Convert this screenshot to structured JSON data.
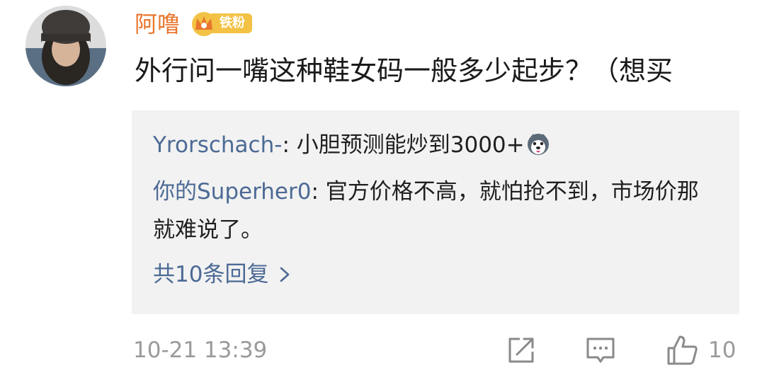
{
  "comment": {
    "username": "阿噜",
    "badge_label": "铁粉",
    "text": "外行问一嘴这种鞋女码一般多少起步？（想买",
    "timestamp": "10-21 13:39",
    "like_count": "10"
  },
  "replies": [
    {
      "author": "Yrorschach-",
      "separator": ": ",
      "text": "小胆预测能炒到3000+",
      "emoji": "husky-emoji"
    },
    {
      "author": "你的Superher0",
      "separator": ": ",
      "text": "官方价格不高，就怕抢不到，市场价那就难说了。"
    }
  ],
  "more_replies_label": "共10条回复",
  "icons": {
    "share": "share-icon",
    "comment": "comment-icon",
    "like": "thumbs-up-icon",
    "crown": "crown-icon",
    "chevron": "chevron-right-icon"
  },
  "colors": {
    "username": "#e8762d",
    "badge": "#f3c244",
    "link_blue": "#4c6a95",
    "reply_bg": "#f2f2f2",
    "meta_gray": "#9a9a9a"
  }
}
